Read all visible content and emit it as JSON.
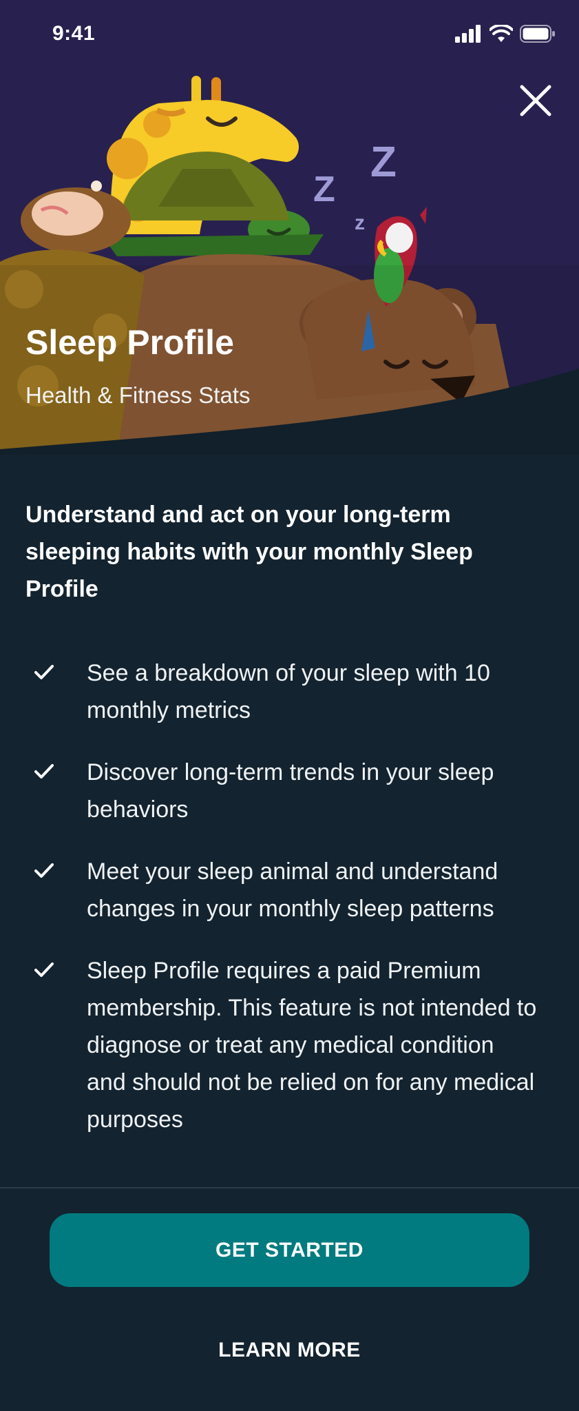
{
  "status_bar": {
    "time": "9:41",
    "icons": [
      "cellular-signal-icon",
      "wifi-icon",
      "battery-icon"
    ]
  },
  "hero": {
    "title": "Sleep Profile",
    "subtitle": "Health & Fitness Stats",
    "sleep_letters": [
      "Z",
      "Z",
      "z"
    ],
    "illustration_animals": [
      "giraffe",
      "turtle",
      "hedgehog",
      "parrot",
      "bear"
    ],
    "close_icon": "close-icon"
  },
  "intro": {
    "text": "Understand and act on your long-term sleeping habits with your monthly Sleep Profile"
  },
  "features": [
    {
      "icon": "checkmark-icon",
      "text": "See a breakdown of your sleep with 10 monthly metrics"
    },
    {
      "icon": "checkmark-icon",
      "text": "Discover long-term trends in your sleep behaviors"
    },
    {
      "icon": "checkmark-icon",
      "text": "Meet your sleep animal and understand changes in your monthly sleep patterns"
    },
    {
      "icon": "checkmark-icon",
      "text": "Sleep Profile requires a paid Premium membership. This feature is not intended to diagnose or treat any medical condition and should not be relied on for any medical purposes"
    }
  ],
  "actions": {
    "primary_label": "GET STARTED",
    "secondary_label": "LEARN MORE"
  },
  "colors": {
    "hero_background": "#28214f",
    "page_background": "#13232f",
    "primary_button": "#017b7f",
    "sleep_letters": "#9e9ad6"
  }
}
